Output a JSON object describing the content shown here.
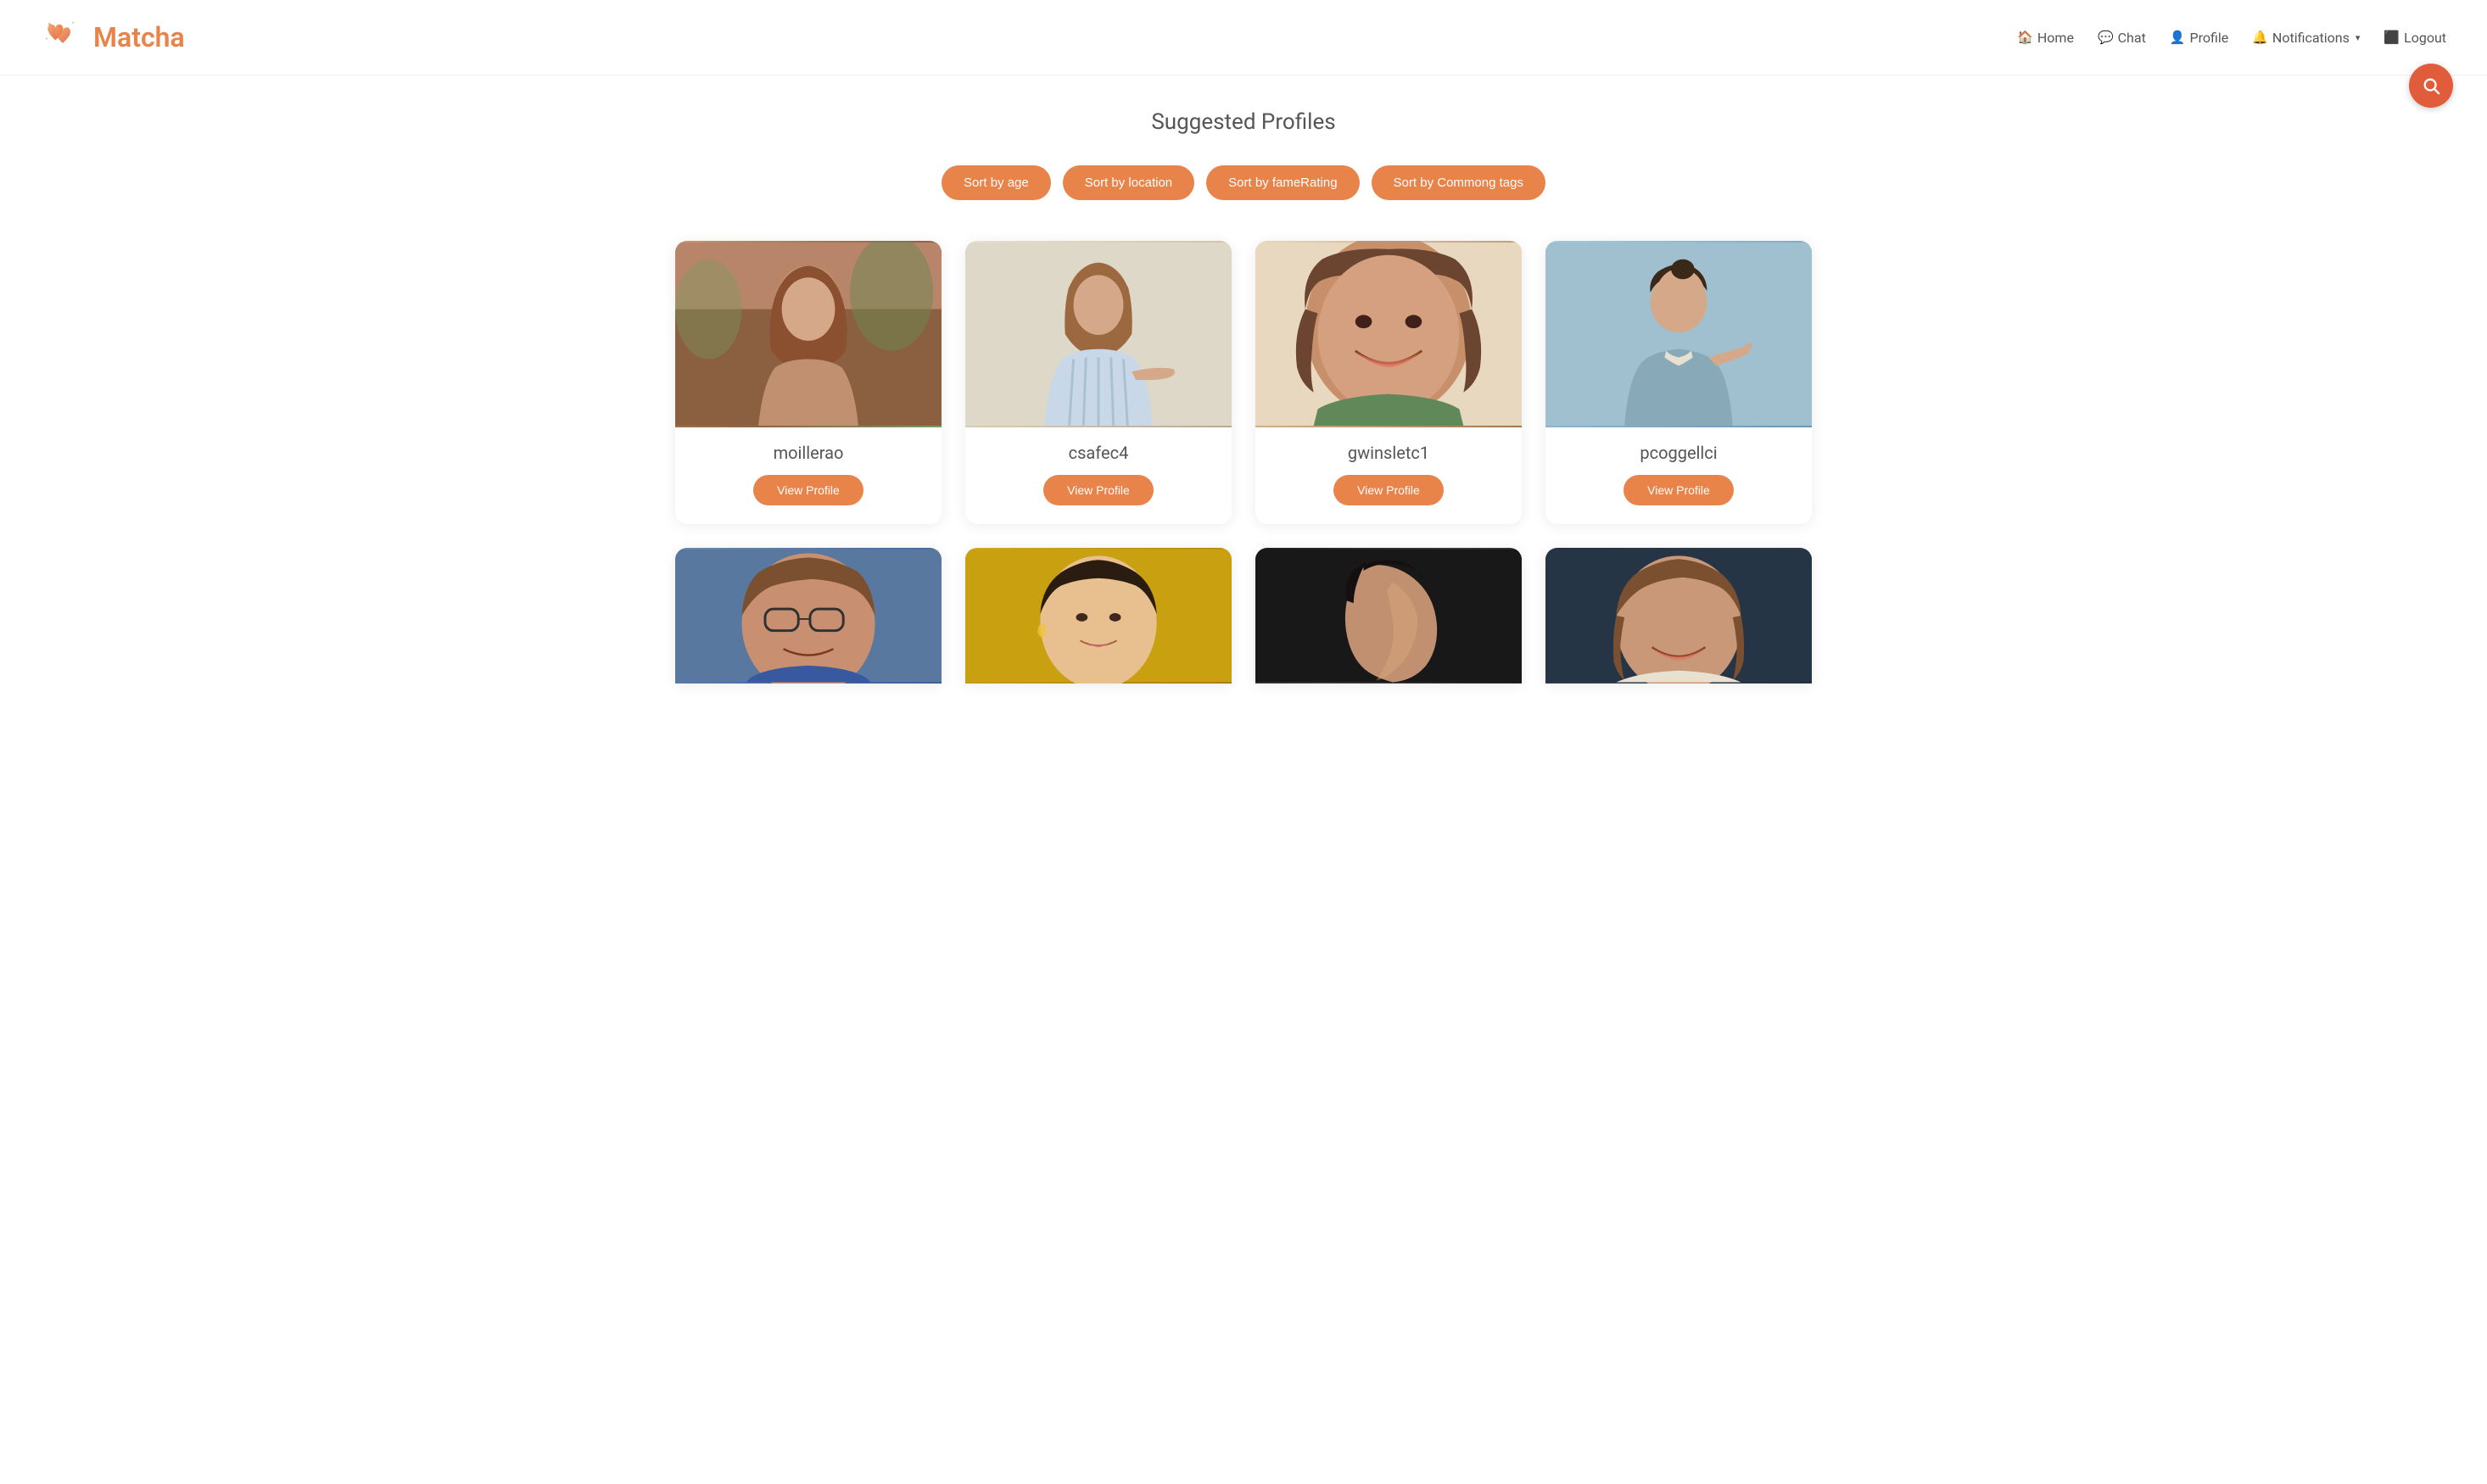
{
  "brand": {
    "name": "Matcha"
  },
  "navbar": {
    "links": [
      {
        "id": "home",
        "label": "Home",
        "icon": "🏠"
      },
      {
        "id": "chat",
        "label": "Chat",
        "icon": "💬"
      },
      {
        "id": "profile",
        "label": "Profile",
        "icon": "👤"
      },
      {
        "id": "notifications",
        "label": "Notifications",
        "icon": "🔔",
        "hasDropdown": true
      },
      {
        "id": "logout",
        "label": "Logout",
        "icon": "🚪"
      }
    ]
  },
  "page": {
    "title": "Suggested Profiles"
  },
  "sort_buttons": [
    {
      "id": "sort-age",
      "label": "Sort by age"
    },
    {
      "id": "sort-location",
      "label": "Sort by location"
    },
    {
      "id": "sort-fame",
      "label": "Sort by fameRating"
    },
    {
      "id": "sort-tags",
      "label": "Sort by Commong tags"
    }
  ],
  "profiles_row1": [
    {
      "id": "moillerao",
      "username": "moillerao",
      "view_label": "View Profile",
      "photo_class": "card-photo-1"
    },
    {
      "id": "csafec4",
      "username": "csafec4",
      "view_label": "View Profile",
      "photo_class": "card-photo-2"
    },
    {
      "id": "gwinsletc1",
      "username": "gwinsletc1",
      "view_label": "View Profile",
      "photo_class": "card-photo-3"
    },
    {
      "id": "pcoggellci",
      "username": "pcoggellci",
      "view_label": "View Profile",
      "photo_class": "card-photo-4"
    }
  ],
  "profiles_row2": [
    {
      "id": "row2-1",
      "photo_class": "card-photo-5"
    },
    {
      "id": "row2-2",
      "photo_class": "card-photo-6"
    },
    {
      "id": "row2-3",
      "photo_class": "card-photo-7"
    },
    {
      "id": "row2-4",
      "photo_class": "card-photo-8"
    }
  ]
}
